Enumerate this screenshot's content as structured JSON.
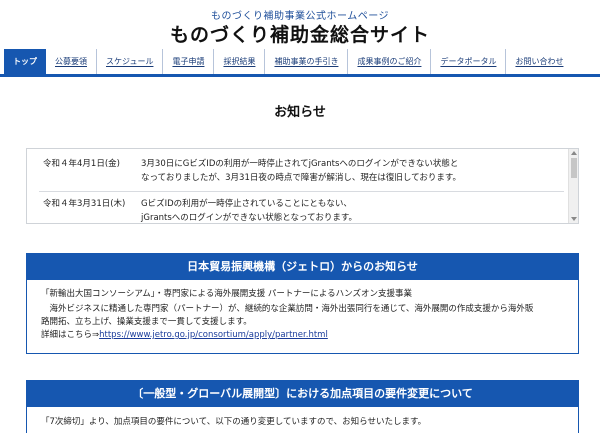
{
  "header": {
    "subtitle": "ものづくり補助事業公式ホームページ",
    "title": "ものづくり補助金総合サイト"
  },
  "nav": {
    "items": [
      {
        "label": "トップ",
        "active": true
      },
      {
        "label": "公募要領"
      },
      {
        "label": "スケジュール"
      },
      {
        "label": "電子申請"
      },
      {
        "label": "採択結果"
      },
      {
        "label": "補助事業の手引き"
      },
      {
        "label": "成果事例のご紹介"
      },
      {
        "label": "データポータル"
      },
      {
        "label": "お問い合わせ"
      }
    ]
  },
  "news": {
    "heading": "お知らせ",
    "items": [
      {
        "date": "令和４年4月1日(金)",
        "line1": "3月30日にGビズIDの利用が一時停止されてjGrantsへのログインができない状態と",
        "line2": "なっておりましたが、3月31日夜の時点で障害が解消し、現在は復旧しております。"
      },
      {
        "date": "令和４年3月31日(木)",
        "line1": "GビズIDの利用が一時停止されていることにともない、",
        "line2": "jGrantsへのログインができない状態となっております。"
      }
    ]
  },
  "jetro_card": {
    "title": "日本貿易振興機構（ジェトロ）からのお知らせ",
    "headline": "「新輸出大国コンソーシアム」・専門家による海外展開支援 パートナーによるハンズオン支援事業",
    "body_line1": "　海外ビジネスに精通した専門家（パートナー）が、継続的な企業訪問・海外出張同行を通じて、海外展開の作成支援から海外販",
    "body_line2": "路開拓、立ち上げ、操業支援まで一貫して支援します。",
    "link_prefix": "詳細はこちら⇒",
    "link_text": "https://www.jetro.go.jp/consortium/apply/partner.html"
  },
  "requirement_card": {
    "title": "〔一般型・グローバル展開型〕における加点項目の要件変更について",
    "body": "「7次締切」より、加点項目の要件について、以下の通り変更していますので、お知らせいたします。"
  },
  "colors": {
    "accent": "#1657b0",
    "subtitle": "#1f4f9a"
  }
}
